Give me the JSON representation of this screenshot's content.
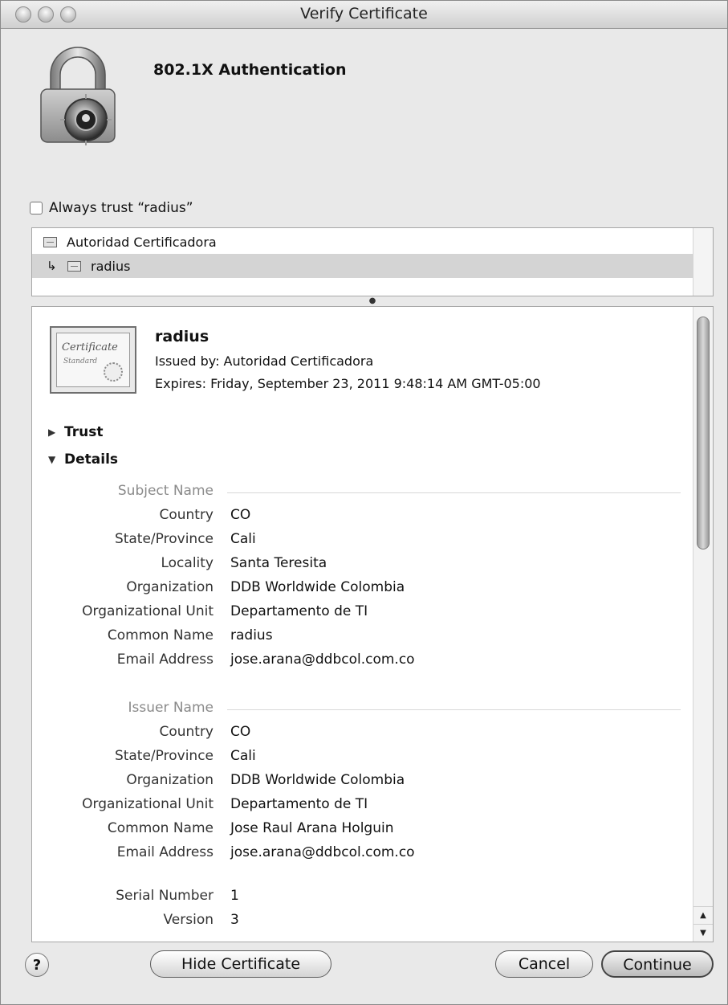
{
  "window": {
    "title": "Verify Certificate"
  },
  "header": {
    "heading": "802.1X Authentication"
  },
  "trust_option": {
    "label": "Always trust “radius”",
    "checked": false
  },
  "chain": {
    "items": [
      {
        "label": "Autoridad Certificadora",
        "indent": 0,
        "selected": false
      },
      {
        "label": "radius",
        "indent": 1,
        "selected": true
      }
    ]
  },
  "certificate": {
    "badge_title": "Certificate",
    "badge_subtitle": "Standard",
    "name": "radius",
    "issued_by": "Issued by: Autoridad Certificadora",
    "expires": "Expires: Friday, September 23, 2011 9:48:14 AM GMT-05:00",
    "trust_label": "Trust",
    "details_label": "Details"
  },
  "details": {
    "subject_section": "Subject Name",
    "subject": [
      {
        "key": "Country",
        "value": "CO"
      },
      {
        "key": "State/Province",
        "value": "Cali"
      },
      {
        "key": "Locality",
        "value": "Santa Teresita"
      },
      {
        "key": "Organization",
        "value": "DDB Worldwide Colombia"
      },
      {
        "key": "Organizational Unit",
        "value": "Departamento de TI"
      },
      {
        "key": "Common Name",
        "value": "radius"
      },
      {
        "key": "Email Address",
        "value": "jose.arana@ddbcol.com.co"
      }
    ],
    "issuer_section": "Issuer Name",
    "issuer": [
      {
        "key": "Country",
        "value": "CO"
      },
      {
        "key": "State/Province",
        "value": "Cali"
      },
      {
        "key": "Organization",
        "value": "DDB Worldwide Colombia"
      },
      {
        "key": "Organizational Unit",
        "value": "Departamento de TI"
      },
      {
        "key": "Common Name",
        "value": "Jose Raul Arana Holguin"
      },
      {
        "key": "Email Address",
        "value": "jose.arana@ddbcol.com.co"
      }
    ],
    "serial": {
      "key": "Serial Number",
      "value": "1"
    },
    "version": {
      "key": "Version",
      "value": "3"
    }
  },
  "buttons": {
    "help": "?",
    "hide_certificate": "Hide Certificate",
    "cancel": "Cancel",
    "continue": "Continue"
  },
  "icons": {
    "lock": "padlock-certificate-icon",
    "cert": "certificate-icon",
    "disclosure_closed": "triangle-right-icon",
    "disclosure_open": "triangle-down-icon"
  }
}
